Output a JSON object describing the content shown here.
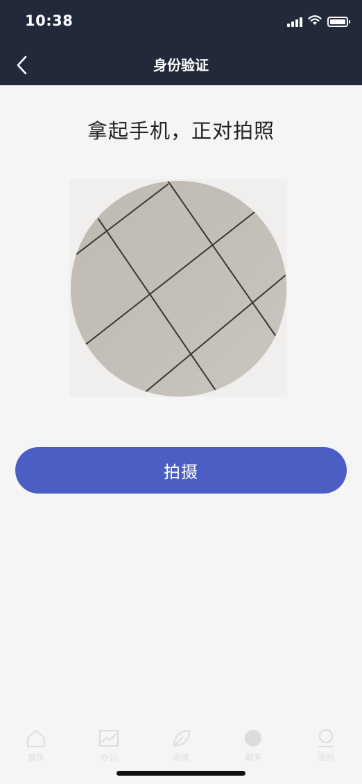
{
  "status_bar": {
    "time": "10:38"
  },
  "nav": {
    "title": "身份验证"
  },
  "content": {
    "prompt": "拿起手机，正对拍照",
    "capture_label": "拍摄"
  },
  "tab_bar": {
    "items": [
      {
        "label": "首页",
        "icon": "home-icon"
      },
      {
        "label": "办公",
        "icon": "chart-icon"
      },
      {
        "label": "阅读",
        "icon": "leaf-icon"
      },
      {
        "label": "聊天",
        "icon": "chat-icon"
      },
      {
        "label": "我的",
        "icon": "user-icon"
      }
    ]
  },
  "colors": {
    "header_bg": "#222a3a",
    "page_bg": "#f5f5f5",
    "accent": "#4b5ec3"
  }
}
